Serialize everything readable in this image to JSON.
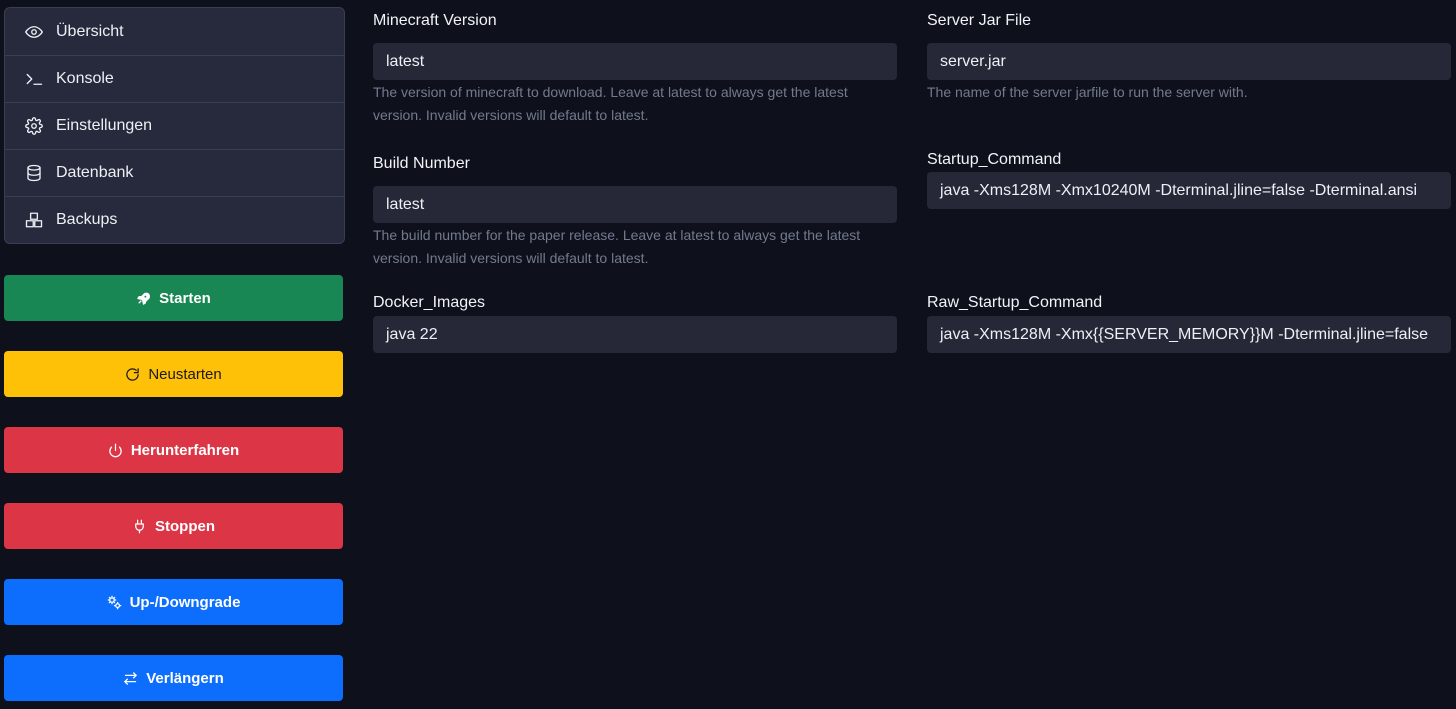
{
  "sidebar": {
    "items": [
      {
        "label": "Übersicht",
        "icon": "eye-icon"
      },
      {
        "label": "Konsole",
        "icon": "terminal-icon"
      },
      {
        "label": "Einstellungen",
        "icon": "gear-icon"
      },
      {
        "label": "Datenbank",
        "icon": "database-icon"
      },
      {
        "label": "Backups",
        "icon": "boxes-icon"
      }
    ]
  },
  "actions": {
    "start": {
      "label": "Starten",
      "icon": "rocket-icon",
      "color": "#198754"
    },
    "restart": {
      "label": "Neustarten",
      "icon": "restart-icon",
      "color": "#ffc107"
    },
    "shutdown": {
      "label": "Herunterfahren",
      "icon": "power-icon",
      "color": "#dc3545"
    },
    "stop": {
      "label": "Stoppen",
      "icon": "plug-icon",
      "color": "#dc3545"
    },
    "upgrade": {
      "label": "Up-/Downgrade",
      "icon": "gears-icon",
      "color": "#0d6efd"
    },
    "extend": {
      "label": "Verlängern",
      "icon": "arrows-exchange-icon",
      "color": "#0d6efd"
    }
  },
  "fields": {
    "minecraft_version": {
      "label": "Minecraft Version",
      "value": "latest",
      "help": "The version of minecraft to download. Leave at latest to always get the latest version. Invalid versions will default to latest."
    },
    "server_jar": {
      "label": "Server Jar File",
      "value": "server.jar",
      "help": "The name of the server jarfile to run the server with."
    },
    "build_number": {
      "label": "Build Number",
      "value": "latest",
      "help": "The build number for the paper release. Leave at latest to always get the latest version. Invalid versions will default to latest."
    },
    "startup_command": {
      "label": "Startup_Command",
      "value": "java -Xms128M -Xmx10240M -Dterminal.jline=false -Dterminal.ansi"
    },
    "docker_images": {
      "label": "Docker_Images",
      "value": "java 22"
    },
    "raw_startup_command": {
      "label": "Raw_Startup_Command",
      "value": "java -Xms128M -Xmx{{SERVER_MEMORY}}M -Dterminal.jline=false"
    }
  }
}
